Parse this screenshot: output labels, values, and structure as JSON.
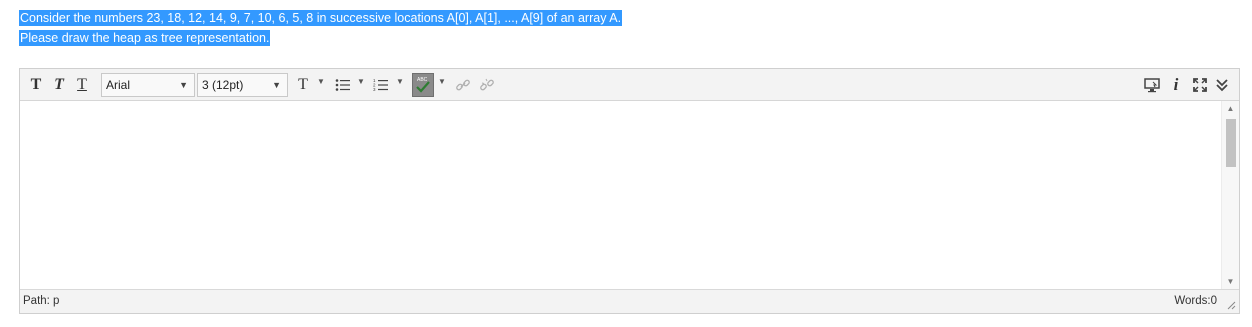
{
  "question": {
    "line1": "Consider the numbers 23, 18, 12, 14, 9, 7, 10, 6, 5, 8 in successive locations A[0], A[1], ..., A[9] of an array A.",
    "line2": "Please draw the heap as tree representation."
  },
  "toolbar": {
    "font_family": "Arial",
    "font_size": "3 (12pt)",
    "icons": [
      "text-bold-icon",
      "text-italic-icon",
      "text-underline-icon",
      "text-color-icon",
      "bullet-list-icon",
      "numbered-list-icon",
      "spellcheck-icon",
      "link-icon",
      "unlink-icon",
      "preview-icon",
      "info-icon",
      "fullscreen-icon",
      "collapse-icon"
    ]
  },
  "editor": {
    "content": ""
  },
  "status": {
    "path": "Path: p",
    "words": "Words:0"
  },
  "colors": {
    "selection": "#3399ff",
    "toolbar_bg": "#f3f3f3"
  }
}
